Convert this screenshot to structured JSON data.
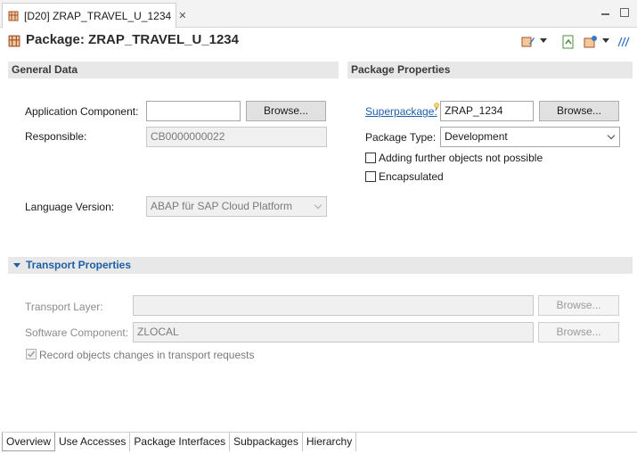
{
  "editor_tab": {
    "label": "[D20] ZRAP_TRAVEL_U_1234",
    "close_glyph": "✕"
  },
  "header": {
    "title": "Package: ZRAP_TRAVEL_U_1234"
  },
  "general": {
    "section_title": "General Data",
    "app_component_label": "Application Component:",
    "app_component_value": "",
    "browse_label": "Browse...",
    "responsible_label": "Responsible:",
    "responsible_value": "CB0000000022",
    "language_label": "Language Version:",
    "language_value": "ABAP für SAP Cloud Platform"
  },
  "package_props": {
    "section_title": "Package Properties",
    "superpackage_label": "Superpackage:",
    "superpackage_value": "ZRAP_1234",
    "browse_label": "Browse...",
    "package_type_label": "Package Type:",
    "package_type_value": "Development",
    "adding_further_label": "Adding further objects not possible",
    "adding_further_checked": false,
    "encapsulated_label": "Encapsulated",
    "encapsulated_checked": false
  },
  "transport": {
    "section_title": "Transport Properties",
    "layer_label": "Transport Layer:",
    "layer_value": "",
    "software_label": "Software Component:",
    "software_value": "ZLOCAL",
    "browse_label": "Browse...",
    "record_label": "Record objects changes in transport requests",
    "record_checked": true
  },
  "bottom_tabs": [
    "Overview",
    "Use Accesses",
    "Package Interfaces",
    "Subpackages",
    "Hierarchy"
  ],
  "colors": {
    "link": "#1a5ea8",
    "section_blue": "#1d5fa5",
    "section_bg": "#e8e8e8"
  },
  "icons": {
    "package": "package-icon",
    "toolbar": [
      "pencil-toolbar-icon",
      "export-icon",
      "transport-icon",
      "more-icon"
    ]
  }
}
